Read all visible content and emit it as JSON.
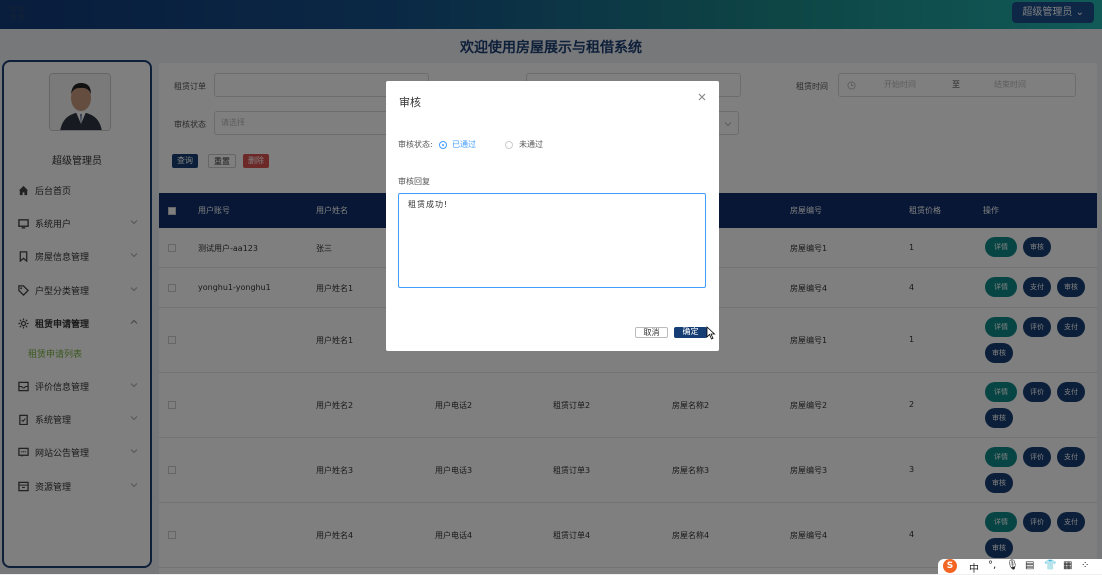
{
  "header": {
    "admin_label": "超级管理员",
    "page_title": "欢迎使用房屋展示与租借系统"
  },
  "sidebar": {
    "user_name": "超级管理员",
    "items": [
      {
        "label": "后台首页"
      },
      {
        "label": "系统用户"
      },
      {
        "label": "房屋信息管理"
      },
      {
        "label": "户型分类管理"
      },
      {
        "label": "租赁申请管理"
      },
      {
        "label": "评价信息管理"
      },
      {
        "label": "系统管理"
      },
      {
        "label": "网站公告管理"
      },
      {
        "label": "资源管理"
      }
    ],
    "sub_item": "租赁申请列表"
  },
  "search": {
    "order_label": "租赁订单",
    "time_label": "租赁时间",
    "start_placeholder": "开始时间",
    "to_label": "至",
    "end_placeholder": "结束时间",
    "status_label": "审核状态",
    "status_placeholder": "请选择",
    "query": "查询",
    "reset": "重置",
    "delete": "删除"
  },
  "table": {
    "headers": {
      "account": "用户账号",
      "name": "用户姓名",
      "house_no": "房屋编号",
      "price": "租赁价格",
      "ops": "操作"
    },
    "rows": [
      {
        "account": "测试用户-aa123",
        "name": "张三",
        "phone": "",
        "order": "",
        "house": "",
        "house_no": "房屋编号1",
        "price": "1",
        "ops": [
          "详情",
          "审核"
        ]
      },
      {
        "account": "yonghu1-yonghu1",
        "name": "用户姓名1",
        "phone": "",
        "order": "",
        "house": "",
        "house_no": "房屋编号4",
        "price": "4",
        "ops": [
          "详情",
          "支付",
          "审核"
        ]
      },
      {
        "account": "",
        "name": "用户姓名1",
        "phone": "",
        "order": "",
        "house": "",
        "house_no": "房屋编号1",
        "price": "1",
        "ops": [
          "详情",
          "评价",
          "支付",
          "审核"
        ]
      },
      {
        "account": "",
        "name": "用户姓名2",
        "phone": "用户电话2",
        "order": "租赁订单2",
        "house": "房屋名称2",
        "house_no": "房屋编号2",
        "price": "2",
        "ops": [
          "详情",
          "评价",
          "支付",
          "审核"
        ]
      },
      {
        "account": "",
        "name": "用户姓名3",
        "phone": "用户电话3",
        "order": "租赁订单3",
        "house": "房屋名称3",
        "house_no": "房屋编号3",
        "price": "3",
        "ops": [
          "详情",
          "评价",
          "支付",
          "审核"
        ]
      },
      {
        "account": "",
        "name": "用户姓名4",
        "phone": "用户电话4",
        "order": "租赁订单4",
        "house": "房屋名称4",
        "house_no": "房屋编号4",
        "price": "4",
        "ops": [
          "详情",
          "评价",
          "支付",
          "审核"
        ]
      }
    ]
  },
  "dialog": {
    "title": "审核",
    "status_label": "审核状态:",
    "option_pass": "已通过",
    "option_fail": "未通过",
    "reply_label": "审核回复",
    "reply_value": "租赁成功!",
    "cancel": "取消",
    "confirm": "确定"
  },
  "tray": {
    "ime": "中",
    "sogou": "S"
  },
  "colors": {
    "primary": "#0f2e6b",
    "accent": "#409eff",
    "teal": "#0f8a8a",
    "danger": "#d9534f",
    "active": "#77b03a"
  }
}
